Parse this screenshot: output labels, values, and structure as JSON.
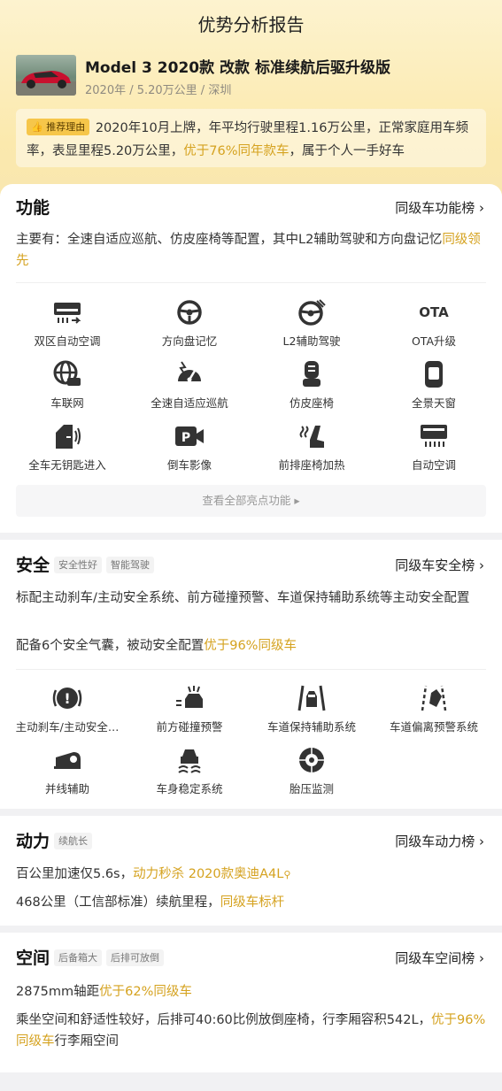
{
  "page": {
    "title": "优势分析报告"
  },
  "car": {
    "title": "Model 3 2020款 改款 标准续航后驱升级版",
    "meta": "2020年 / 5.20万公里 / 深圳"
  },
  "reason": {
    "tag": "推荐理由",
    "text_a": "2020年10月上牌，年平均行驶里程1.16万公里，正常家庭用车频率，表显里程5.20万公里，",
    "highlight": "优于76%同年款车",
    "text_b": "，属于个人一手好车"
  },
  "function": {
    "title": "功能",
    "link": "同级车功能榜 ›",
    "desc_a": "主要有：全速自适应巡航、仿皮座椅等配置，其中L2辅助驾驶和方向盘记忆",
    "desc_hl": "同级领先",
    "items": [
      {
        "label": "双区自动空调",
        "icon": "ac-dual-icon"
      },
      {
        "label": "方向盘记忆",
        "icon": "steering-memory-icon"
      },
      {
        "label": "L2辅助驾驶",
        "icon": "steering-assist-icon"
      },
      {
        "label": "OTA升级",
        "icon": "ota-icon",
        "icon_text": "OTA"
      },
      {
        "label": "车联网",
        "icon": "globe-car-icon"
      },
      {
        "label": "全速自适应巡航",
        "icon": "speedometer-icon"
      },
      {
        "label": "仿皮座椅",
        "icon": "seat-icon"
      },
      {
        "label": "全景天窗",
        "icon": "sunroof-icon"
      },
      {
        "label": "全车无钥匙进入",
        "icon": "keyless-icon"
      },
      {
        "label": "倒车影像",
        "icon": "reverse-camera-icon",
        "icon_text": "P"
      },
      {
        "label": "前排座椅加热",
        "icon": "seat-heat-icon"
      },
      {
        "label": "自动空调",
        "icon": "auto-ac-icon"
      }
    ],
    "more": "查看全部亮点功能 ▸"
  },
  "safety": {
    "title": "安全",
    "tags": [
      "安全性好",
      "智能驾驶"
    ],
    "link": "同级车安全榜 ›",
    "desc1": "标配主动刹车/主动安全系统、前方碰撞预警、车道保持辅助系统等主动安全配置",
    "desc2_a": "配备6个安全气囊，被动安全配置",
    "desc2_hl": "优于96%同级车",
    "items": [
      {
        "label": "主动刹车/主动安全…",
        "icon": "brake-icon",
        "icon_text": "!"
      },
      {
        "label": "前方碰撞预警",
        "icon": "collision-warning-icon"
      },
      {
        "label": "车道保持辅助系统",
        "icon": "lane-keep-icon"
      },
      {
        "label": "车道偏离预警系统",
        "icon": "lane-departure-icon"
      },
      {
        "label": "并线辅助",
        "icon": "merge-assist-icon"
      },
      {
        "label": "车身稳定系统",
        "icon": "stability-icon"
      },
      {
        "label": "胎压监测",
        "icon": "tire-pressure-icon"
      }
    ]
  },
  "power": {
    "title": "动力",
    "tags": [
      "续航长"
    ],
    "link": "同级车动力榜 ›",
    "line1_a": "百公里加速仅5.6s，",
    "line1_hl": "动力秒杀 2020款奥迪A4L",
    "line2_a": "468公里（工信部标准）续航里程，",
    "line2_hl": "同级车标杆"
  },
  "space": {
    "title": "空间",
    "tags": [
      "后备箱大",
      "后排可放倒"
    ],
    "link": "同级车空间榜 ›",
    "line1_a": "2875mm轴距",
    "line1_hl": "优于62%同级车",
    "line2_a": "乘坐空间和舒适性较好，后排可40:60比例放倒座椅，行李厢容积542L，",
    "line2_hl": "优于96%同级车",
    "line2_b": "行李厢空间"
  },
  "colors": {
    "accent": "#d5a21f",
    "tag_bg": "#f6c64a",
    "header": "#fbe9ad"
  }
}
